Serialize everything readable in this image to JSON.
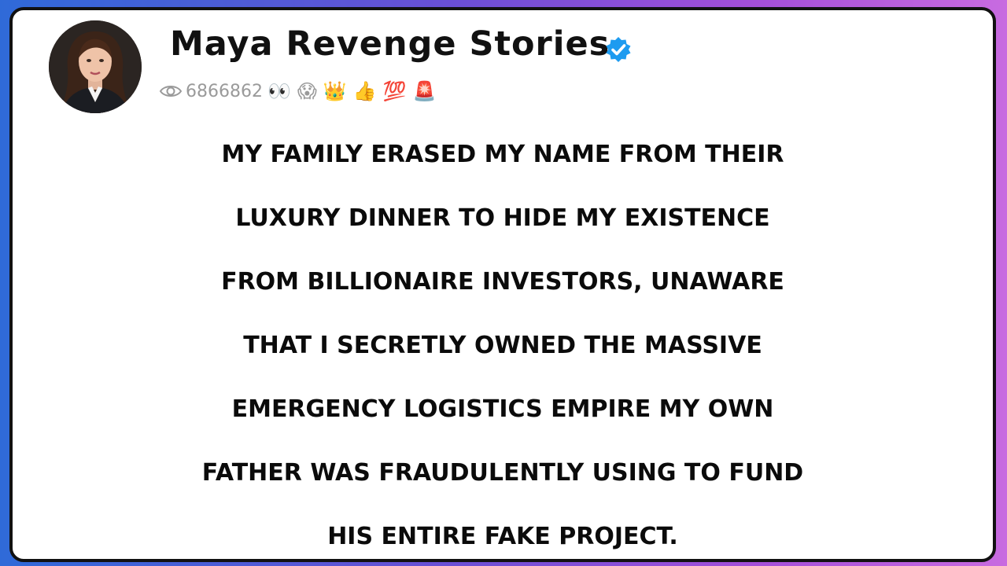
{
  "channel": {
    "name": "Maya Revenge Stories",
    "verified": true,
    "verified_color": "#1d9bf0"
  },
  "stats": {
    "views": "6866862",
    "eye_icon": "eye-icon",
    "emojis": [
      "👀",
      "😱",
      "👑",
      "👍",
      "💯",
      "🚨"
    ]
  },
  "headline": {
    "lines": [
      "MY FAMILY ERASED MY NAME FROM THEIR",
      "LUXURY DINNER TO HIDE MY EXISTENCE",
      "FROM BILLIONAIRE INVESTORS, UNAWARE",
      "THAT I SECRETLY OWNED THE MASSIVE",
      "EMERGENCY LOGISTICS EMPIRE MY OWN",
      "FATHER WAS FRAUDULENTLY USING TO FUND",
      "HIS ENTIRE FAKE PROJECT."
    ]
  },
  "colors": {
    "frame_start": "#2f6ad8",
    "frame_end": "#c86be0",
    "card_bg": "#ffffff",
    "text": "#0b0b0b"
  }
}
